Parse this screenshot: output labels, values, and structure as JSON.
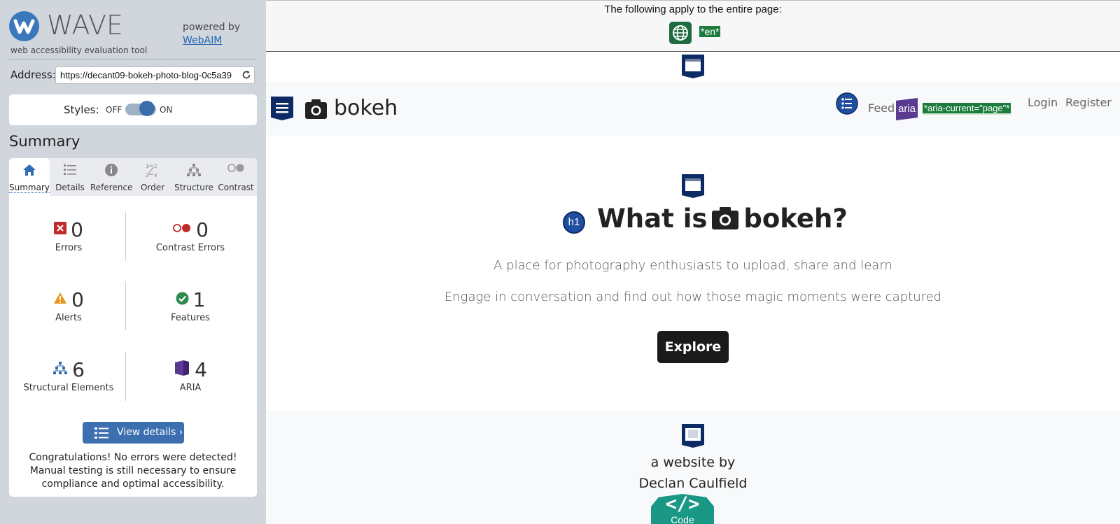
{
  "sidebar": {
    "logo_text": "WAVE",
    "logo_subtitle": "web accessibility evaluation tool",
    "powered_by": "powered by",
    "powered_link": "WebAIM",
    "address_label": "Address:",
    "address_value": "https://decant09-bokeh-photo-blog-0c5a39",
    "styles_label": "Styles:",
    "styles_off": "OFF",
    "styles_on": "ON",
    "styles_state": "on",
    "summary_heading": "Summary",
    "tabs": [
      {
        "label": "Summary",
        "icon": "home-icon",
        "active": true
      },
      {
        "label": "Details",
        "icon": "details-list-icon",
        "active": false
      },
      {
        "label": "Reference",
        "icon": "info-icon",
        "active": false
      },
      {
        "label": "Order",
        "icon": "order-icon",
        "active": false
      },
      {
        "label": "Structure",
        "icon": "structure-icon",
        "active": false
      },
      {
        "label": "Contrast",
        "icon": "contrast-icon",
        "active": false
      }
    ],
    "stats": [
      {
        "value": "0",
        "label": "Errors",
        "icon": "error-icon",
        "color": "#c02b2b"
      },
      {
        "value": "0",
        "label": "Contrast Errors",
        "icon": "contrast-error-icon",
        "color": "#c02b2b"
      },
      {
        "value": "0",
        "label": "Alerts",
        "icon": "alert-icon",
        "color": "#e8951c"
      },
      {
        "value": "1",
        "label": "Features",
        "icon": "feature-icon",
        "color": "#2e8a4f"
      },
      {
        "value": "6",
        "label": "Structural Elements",
        "icon": "structure-icon",
        "color": "#2f6cb3"
      },
      {
        "value": "4",
        "label": "ARIA",
        "icon": "aria-icon",
        "color": "#5a3990"
      }
    ],
    "view_details": "View details ›",
    "congrats": "Congratulations! No errors were detected! Manual testing is still necessary to ensure compliance and optimal accessibility."
  },
  "main": {
    "banner_text": "The following apply to the entire page:",
    "lang_badge": "*en*",
    "brand": "bokeh",
    "nav": {
      "feed": "Feed",
      "aria_badge": "aria",
      "aria_current": "*aria-current=\"page\"*",
      "login": "Login",
      "register": "Register"
    },
    "h1_badge": "h1",
    "hero_title_before": "What is",
    "hero_title_after": "bokeh?",
    "hero_line1": "A place for photography enthusiasts to upload, share and learn",
    "hero_line2": "Engage in conversation and find out how those magic moments were captured",
    "explore_button": "Explore",
    "footer_line1": "a website by",
    "footer_line2": "Declan Caulfield",
    "code_symbol": "</>",
    "code_label": "Code"
  }
}
